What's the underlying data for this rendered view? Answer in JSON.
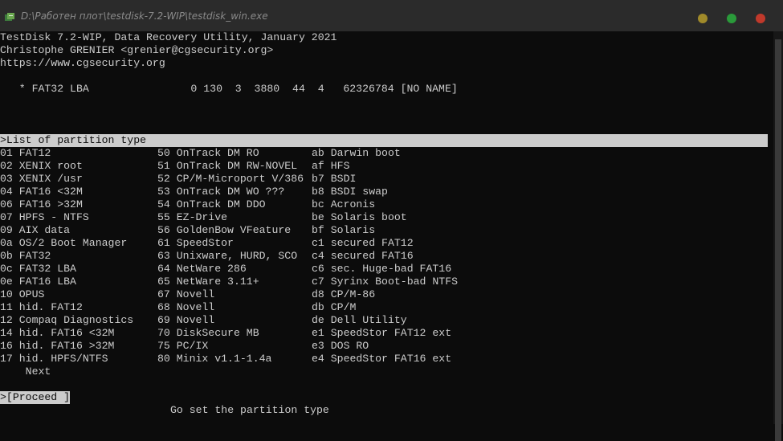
{
  "window": {
    "title": "D:\\Работен плот\\testdisk-7.2-WIP\\testdisk_win.exe",
    "colors": {
      "min": "#a08a2a",
      "max": "#2a9a3a",
      "close": "#c0392b"
    }
  },
  "header": {
    "line1": "TestDisk 7.2-WIP, Data Recovery Utility, January 2021",
    "line2": "Christophe GRENIER <grenier@cgsecurity.org>",
    "line3": "https://www.cgsecurity.org"
  },
  "partition": {
    "line": "   * FAT32 LBA                0 130  3  3880  44  4   62326784 [NO NAME]"
  },
  "list": {
    "heading": ">List of partition type",
    "rows": [
      [
        "01 FAT12",
        "50 OnTrack DM RO",
        "ab Darwin boot"
      ],
      [
        "02 XENIX root",
        "51 OnTrack DM RW-NOVEL",
        "af HFS"
      ],
      [
        "03 XENIX /usr",
        "52 CP/M-Microport V/386",
        "b7 BSDI"
      ],
      [
        "04 FAT16 <32M",
        "53 OnTrack DM WO ???",
        "b8 BSDI swap"
      ],
      [
        "06 FAT16 >32M",
        "54 OnTrack DM DDO",
        "bc Acronis"
      ],
      [
        "07 HPFS - NTFS",
        "55 EZ-Drive",
        "be Solaris boot"
      ],
      [
        "09 AIX data",
        "56 GoldenBow VFeature",
        "bf Solaris"
      ],
      [
        "0a OS/2 Boot Manager",
        "61 SpeedStor",
        "c1 secured FAT12"
      ],
      [
        "0b FAT32",
        "63 Unixware, HURD, SCO",
        "c4 secured FAT16"
      ],
      [
        "0c FAT32 LBA",
        "64 NetWare 286",
        "c6 sec. Huge-bad FAT16"
      ],
      [
        "0e FAT16 LBA",
        "65 NetWare 3.11+",
        "c7 Syrinx Boot-bad NTFS"
      ],
      [
        "10 OPUS",
        "67 Novell",
        "d8 CP/M-86"
      ],
      [
        "11 hid. FAT12",
        "68 Novell",
        "db CP/M"
      ],
      [
        "12 Compaq Diagnostics",
        "69 Novell",
        "de Dell Utility"
      ],
      [
        "14 hid. FAT16 <32M",
        "70 DiskSecure MB",
        "e1 SpeedStor FAT12 ext"
      ],
      [
        "16 hid. FAT16 >32M",
        "75 PC/IX",
        "e3 DOS RO"
      ],
      [
        "17 hid. HPFS/NTFS",
        "80 Minix v1.1-1.4a",
        "e4 SpeedStor FAT16 ext"
      ]
    ],
    "next": "    Next"
  },
  "actions": {
    "proceed": ">[Proceed ]"
  },
  "status": {
    "hint": "Go set the partition type"
  }
}
